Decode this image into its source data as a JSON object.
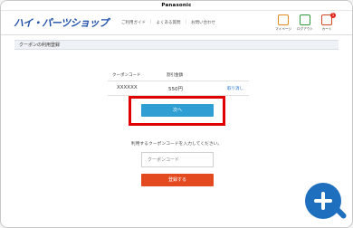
{
  "brand": "Panasonic",
  "logo": "ハイ・パーツショップ",
  "nav": [
    "ご利用ガイド",
    "よくある質問",
    "お問い合わせ"
  ],
  "header_icons": [
    {
      "label": "マイページ",
      "icon": "mypage-icon"
    },
    {
      "label": "ログアウト",
      "icon": "logout-icon"
    },
    {
      "label": "カート",
      "icon": "cart-icon"
    }
  ],
  "cart_count": "1",
  "section_title": "クーポンの利用登録",
  "table": {
    "headers": [
      "クーポンコード",
      "割引金額"
    ],
    "row": {
      "code": "XXXXXX",
      "amount": "550円",
      "cancel": "取り消し"
    }
  },
  "next_button": "次へ",
  "prompt": "利用するクーポンコードを入力してください。",
  "coupon_input": {
    "placeholder": "クーポンコード",
    "value": ""
  },
  "register_button": "登録する",
  "colors": {
    "highlight": "#e00000",
    "next": "#2f9fd3",
    "register": "#e34a1f",
    "zoom": "#1f6fbf"
  }
}
